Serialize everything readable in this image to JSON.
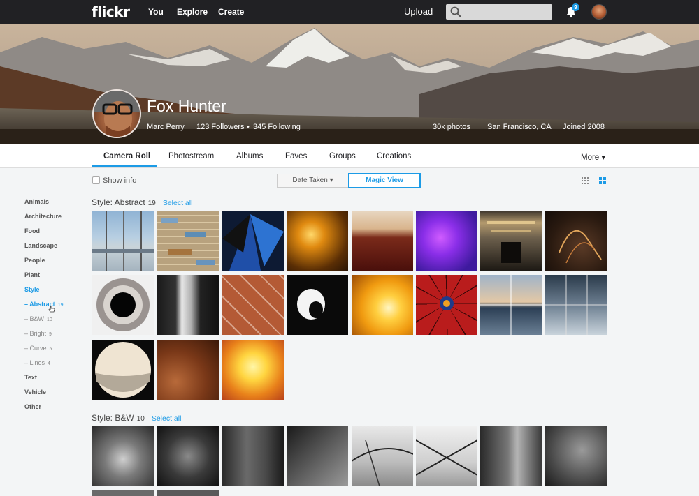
{
  "header": {
    "logo": "flickr",
    "nav": [
      "You",
      "Explore",
      "Create"
    ],
    "upload": "Upload",
    "notifications_count": "9"
  },
  "profile": {
    "display_name": "Fox Hunter",
    "real_name": "Marc Perry",
    "followers": "123 Followers",
    "separator": "•",
    "following": "345 Following",
    "photos": "30k photos",
    "location": "San Francisco, CA",
    "joined": "Joined 2008"
  },
  "tabs": {
    "items": [
      "Camera Roll",
      "Photostream",
      "Albums",
      "Faves",
      "Groups",
      "Creations"
    ],
    "active": "Camera Roll",
    "more": "More ▾"
  },
  "toolbar": {
    "show_info": "Show info",
    "date_taken": "Date Taken ▾",
    "magic_view": "Magic View"
  },
  "sidebar": {
    "items": [
      "Animals",
      "Architecture",
      "Food",
      "Landscape",
      "People",
      "Plant",
      "Style"
    ],
    "style_subs": [
      {
        "label": "– Abstract",
        "count": "19"
      },
      {
        "label": "– B&W",
        "count": "10"
      },
      {
        "label": "– Bright",
        "count": "9"
      },
      {
        "label": "– Curve",
        "count": "5"
      },
      {
        "label": "– Lines",
        "count": "4"
      }
    ],
    "after": [
      "Text",
      "Vehicle",
      "Other"
    ]
  },
  "sections": [
    {
      "title": "Style: Abstract",
      "count": "19",
      "select_all": "Select all"
    },
    {
      "title": "Style: B&W",
      "count": "10",
      "select_all": "Select all"
    }
  ],
  "colors": {
    "accent": "#1c9be6",
    "topbar": "#212124"
  }
}
